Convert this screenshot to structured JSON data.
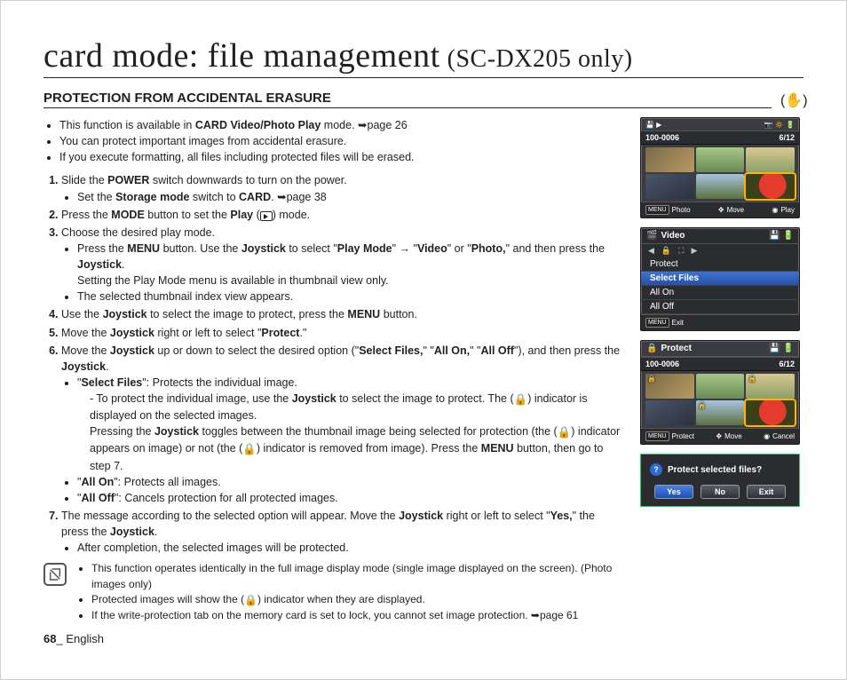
{
  "title": {
    "main": "card mode: file management",
    "sub": "(SC-DX205 only)"
  },
  "section_heading": "PROTECTION FROM ACCIDENTAL ERASURE",
  "intro": [
    "This function is available in CARD Video/Photo Play mode. ➥page 26",
    "You can protect important images from accidental erasure.",
    "If you execute formatting, all files including protected files will be erased."
  ],
  "steps": {
    "s1": "Slide the POWER switch downwards to turn on the power.",
    "s1a": "Set the Storage mode switch to CARD. ➥page 38",
    "s2": "Press the MODE button to set the Play (▶) mode.",
    "s3": "Choose the desired play mode.",
    "s3a_pre": "Press the MENU button. Use the Joystick to select \"Play Mode\" → \"Video\" or \"Photo,\" and then press the Joystick.",
    "s3a_post": "Setting the Play Mode menu is available in thumbnail view only.",
    "s3b": "The selected thumbnail index view appears.",
    "s4": "Use the Joystick to select the image to protect, press the MENU button.",
    "s5": "Move the Joystick right or left to select \"Protect.\"",
    "s6": "Move the Joystick up or down to select the desired option (\"Select Files,\" \"All On,\" \"All Off\"), and then press the Joystick.",
    "s6a": "\"Select Files\": Protects the individual image.",
    "s6a1": "To protect the individual image, use the Joystick to select the image to protect. The (🔒) indicator is displayed on the selected images. Pressing the Joystick toggles between the thumbnail image being selected for protection (the (🔒) indicator appears on image) or not (the (🔒) indicator is removed from image). Press the MENU button, then go to step 7.",
    "s6b": "\"All On\": Protects all images.",
    "s6c": "\"All Off\": Cancels protection for all protected images.",
    "s7": "The message according to the selected option will appear. Move the Joystick right or left to select \"Yes,\" the press the Joystick.",
    "s7a": "After completion, the selected images will be protected."
  },
  "notes": [
    "This function operates identically in the full image display mode (single image displayed on the screen). (Photo images only)",
    "Protected images will show the (🔒) indicator when they are displayed.",
    "If the write-protection tab on the memory card is set to lock, you cannot set image protection. ➥page 61"
  ],
  "footer": {
    "page": "68",
    "sep": "_",
    "lang": "English"
  },
  "lcd1": {
    "index": "100-0006",
    "count": "6/12",
    "bot_l": "Photo",
    "bot_m": "Move",
    "bot_r": "Play"
  },
  "lcd2": {
    "title": "Video",
    "item_protect": "Protect",
    "items": [
      "Select Files",
      "All On",
      "All Off"
    ],
    "exit": "Exit"
  },
  "lcd3": {
    "title": "Protect",
    "index": "100-0006",
    "count": "6/12",
    "bot_l": "Protect",
    "bot_m": "Move",
    "bot_r": "Cancel"
  },
  "dialog": {
    "q": "Protect selected files?",
    "yes": "Yes",
    "no": "No",
    "exit": "Exit"
  }
}
